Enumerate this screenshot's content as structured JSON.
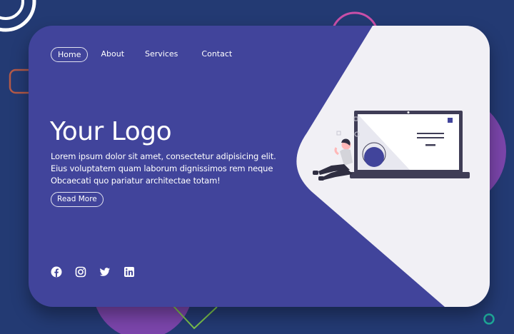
{
  "nav": {
    "items": [
      {
        "label": "Home",
        "active": true
      },
      {
        "label": "About"
      },
      {
        "label": "Services"
      },
      {
        "label": "Contact"
      }
    ]
  },
  "hero": {
    "title": "Your Logo",
    "description": "Lorem ipsum dolor sit amet, consectetur adipisicing elit. Eius voluptatem quam laborum dignissimos rem neque Obcaecati quo pariatur architectae totam!",
    "cta_label": "Read More"
  },
  "social": {
    "icons": [
      "facebook-icon",
      "instagram-icon",
      "twitter-icon",
      "linkedin-icon"
    ]
  },
  "colors": {
    "background": "#233a73",
    "card": "#41449b",
    "panel": "#f1f0f5",
    "accent_purple": "#7b45ab",
    "accent_pink": "#c94fa8",
    "accent_green": "#7cc34b",
    "accent_teal": "#1ea796",
    "accent_orange": "#b45a48"
  }
}
